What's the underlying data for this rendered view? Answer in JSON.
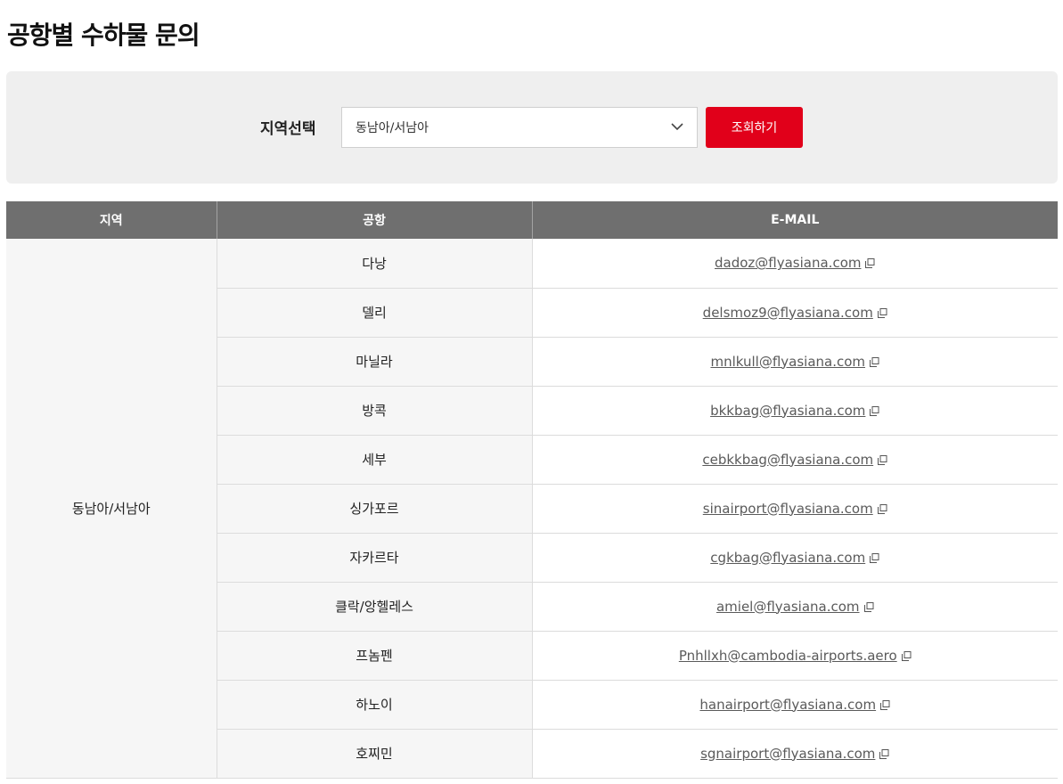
{
  "page": {
    "title": "공항별 수하물 문의"
  },
  "search": {
    "label": "지역선택",
    "selected": "동남아/서남아",
    "button_label": "조회하기"
  },
  "colors": {
    "accent": "#e1001a",
    "header_bg": "#6f6f6f",
    "panel_bg": "#efefef"
  },
  "table": {
    "headers": [
      "지역",
      "공항",
      "E-MAIL"
    ],
    "region": "동남아/서남아",
    "rows": [
      {
        "airport": "다낭",
        "email": "dadoz@flyasiana.com"
      },
      {
        "airport": "델리",
        "email": "delsmoz9@flyasiana.com"
      },
      {
        "airport": "마닐라",
        "email": "mnlkull@flyasiana.com"
      },
      {
        "airport": "방콕",
        "email": "bkkbag@flyasiana.com"
      },
      {
        "airport": "세부",
        "email": "cebkkbag@flyasiana.com"
      },
      {
        "airport": "싱가포르",
        "email": "sinairport@flyasiana.com"
      },
      {
        "airport": "자카르타",
        "email": "cgkbag@flyasiana.com"
      },
      {
        "airport": "클락/앙헬레스",
        "email": "amiel@flyasiana.com"
      },
      {
        "airport": "프놈펜",
        "email": "Pnhllxh@cambodia-airports.aero"
      },
      {
        "airport": "하노이",
        "email": "hanairport@flyasiana.com"
      },
      {
        "airport": "호찌민",
        "email": "sgnairport@flyasiana.com"
      }
    ]
  },
  "icons": {
    "select_chevron": "chevron-down-icon",
    "email_link": "new-window-icon"
  }
}
